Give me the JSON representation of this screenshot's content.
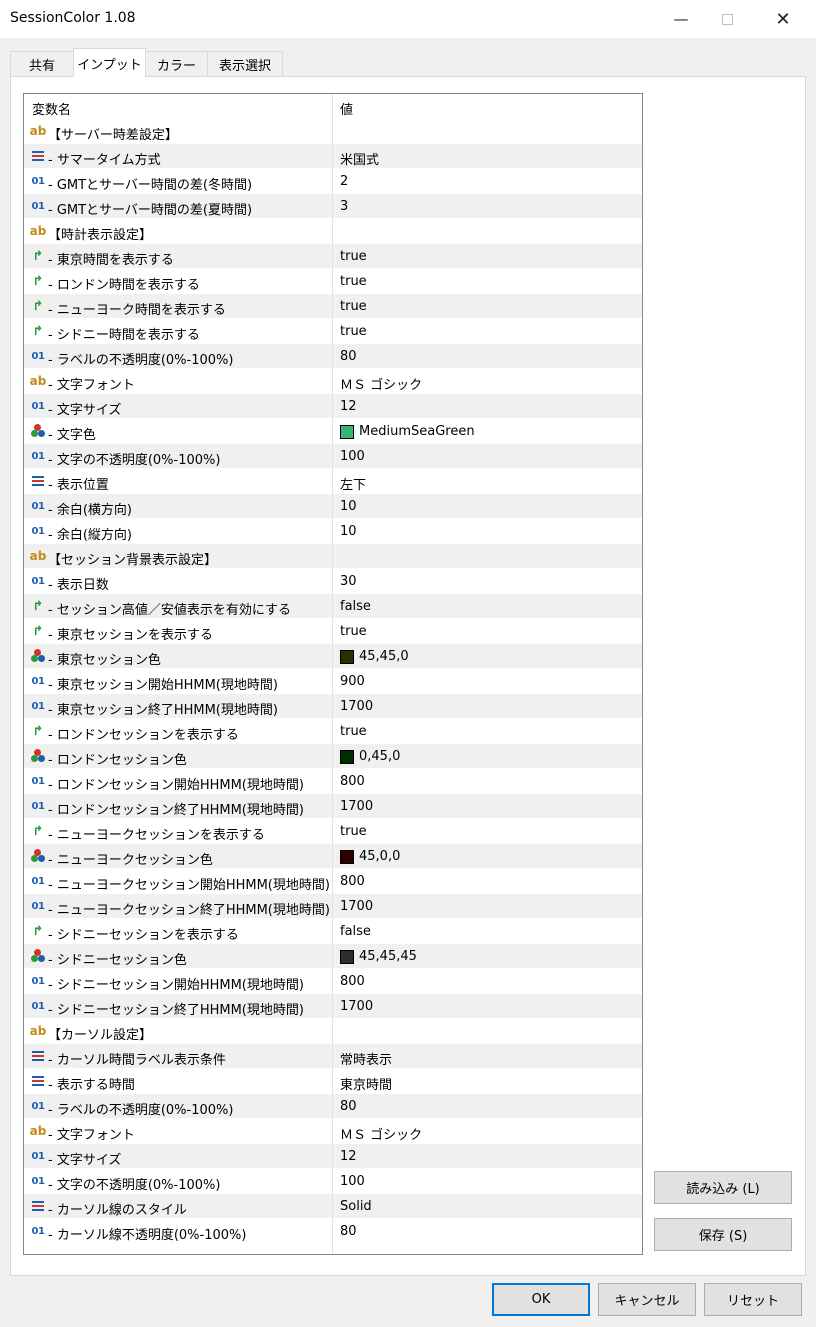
{
  "window": {
    "title": "SessionColor 1.08",
    "minimize": "—",
    "close": "✕"
  },
  "tabs": [
    "共有",
    "インプット",
    "カラー",
    "表示選択"
  ],
  "grid": {
    "col_name": "変数名",
    "col_value": "値",
    "rows": [
      {
        "type": "ab",
        "name": "【サーバー時差設定】",
        "value": ""
      },
      {
        "type": "enum",
        "name": " - サマータイム方式",
        "value": "米国式"
      },
      {
        "type": "num",
        "name": " - GMTとサーバー時間の差(冬時間)",
        "value": "2"
      },
      {
        "type": "num",
        "name": " - GMTとサーバー時間の差(夏時間)",
        "value": "3"
      },
      {
        "type": "ab",
        "name": "【時計表示設定】",
        "value": ""
      },
      {
        "type": "bool",
        "name": " - 東京時間を表示する",
        "value": "true"
      },
      {
        "type": "bool",
        "name": " - ロンドン時間を表示する",
        "value": "true"
      },
      {
        "type": "bool",
        "name": " - ニューヨーク時間を表示する",
        "value": "true"
      },
      {
        "type": "bool",
        "name": " - シドニー時間を表示する",
        "value": "true"
      },
      {
        "type": "num",
        "name": " - ラベルの不透明度(0%-100%)",
        "value": "80"
      },
      {
        "type": "ab",
        "name": " - 文字フォント",
        "value": "ＭＳ ゴシック"
      },
      {
        "type": "num",
        "name": " - 文字サイズ",
        "value": "12"
      },
      {
        "type": "color",
        "name": " - 文字色",
        "value": "MediumSeaGreen",
        "swatch": "#3cb371"
      },
      {
        "type": "num",
        "name": " - 文字の不透明度(0%-100%)",
        "value": "100"
      },
      {
        "type": "enum",
        "name": " - 表示位置",
        "value": "左下"
      },
      {
        "type": "num",
        "name": " - 余白(横方向)",
        "value": "10"
      },
      {
        "type": "num",
        "name": " - 余白(縦方向)",
        "value": "10"
      },
      {
        "type": "ab",
        "name": "【セッション背景表示設定】",
        "value": ""
      },
      {
        "type": "num",
        "name": " - 表示日数",
        "value": "30"
      },
      {
        "type": "bool",
        "name": " - セッション高値／安値表示を有効にする",
        "value": "false"
      },
      {
        "type": "bool",
        "name": " - 東京セッションを表示する",
        "value": "true"
      },
      {
        "type": "color",
        "name": " - 東京セッション色",
        "value": "45,45,0",
        "swatch": "#2d2d00"
      },
      {
        "type": "num",
        "name": " - 東京セッション開始HHMM(現地時間)",
        "value": "900"
      },
      {
        "type": "num",
        "name": " - 東京セッション終了HHMM(現地時間)",
        "value": "1700"
      },
      {
        "type": "bool",
        "name": " - ロンドンセッションを表示する",
        "value": "true"
      },
      {
        "type": "color",
        "name": " - ロンドンセッション色",
        "value": "0,45,0",
        "swatch": "#002d00"
      },
      {
        "type": "num",
        "name": " - ロンドンセッション開始HHMM(現地時間)",
        "value": "800"
      },
      {
        "type": "num",
        "name": " - ロンドンセッション終了HHMM(現地時間)",
        "value": "1700"
      },
      {
        "type": "bool",
        "name": " - ニューヨークセッションを表示する",
        "value": "true"
      },
      {
        "type": "color",
        "name": " - ニューヨークセッション色",
        "value": "45,0,0",
        "swatch": "#2d0000"
      },
      {
        "type": "num",
        "name": " - ニューヨークセッション開始HHMM(現地時間)",
        "value": "800"
      },
      {
        "type": "num",
        "name": " - ニューヨークセッション終了HHMM(現地時間)",
        "value": "1700"
      },
      {
        "type": "bool",
        "name": " - シドニーセッションを表示する",
        "value": "false"
      },
      {
        "type": "color",
        "name": " - シドニーセッション色",
        "value": "45,45,45",
        "swatch": "#2d2d2d"
      },
      {
        "type": "num",
        "name": " - シドニーセッション開始HHMM(現地時間)",
        "value": "800"
      },
      {
        "type": "num",
        "name": " - シドニーセッション終了HHMM(現地時間)",
        "value": "1700"
      },
      {
        "type": "ab",
        "name": "【カーソル設定】",
        "value": ""
      },
      {
        "type": "enum",
        "name": " - カーソル時間ラベル表示条件",
        "value": "常時表示"
      },
      {
        "type": "enum",
        "name": " - 表示する時間",
        "value": "東京時間"
      },
      {
        "type": "num",
        "name": " - ラベルの不透明度(0%-100%)",
        "value": "80"
      },
      {
        "type": "ab",
        "name": " - 文字フォント",
        "value": "ＭＳ ゴシック"
      },
      {
        "type": "num",
        "name": " - 文字サイズ",
        "value": "12"
      },
      {
        "type": "num",
        "name": " - 文字の不透明度(0%-100%)",
        "value": "100"
      },
      {
        "type": "enum",
        "name": " - カーソル線のスタイル",
        "value": "Solid"
      },
      {
        "type": "num",
        "name": " - カーソル線不透明度(0%-100%)",
        "value": "80"
      }
    ]
  },
  "side_buttons": {
    "load": "読み込み (L)",
    "save": "保存 (S)"
  },
  "footer_buttons": {
    "ok": "OK",
    "cancel": "キャンセル",
    "reset": "リセット"
  },
  "colors": {
    "accent": "#0078d7",
    "ab_icon": "#c28a1e",
    "num_icon": "#1c5fb0",
    "bool_icon": "#2a9a3a"
  }
}
